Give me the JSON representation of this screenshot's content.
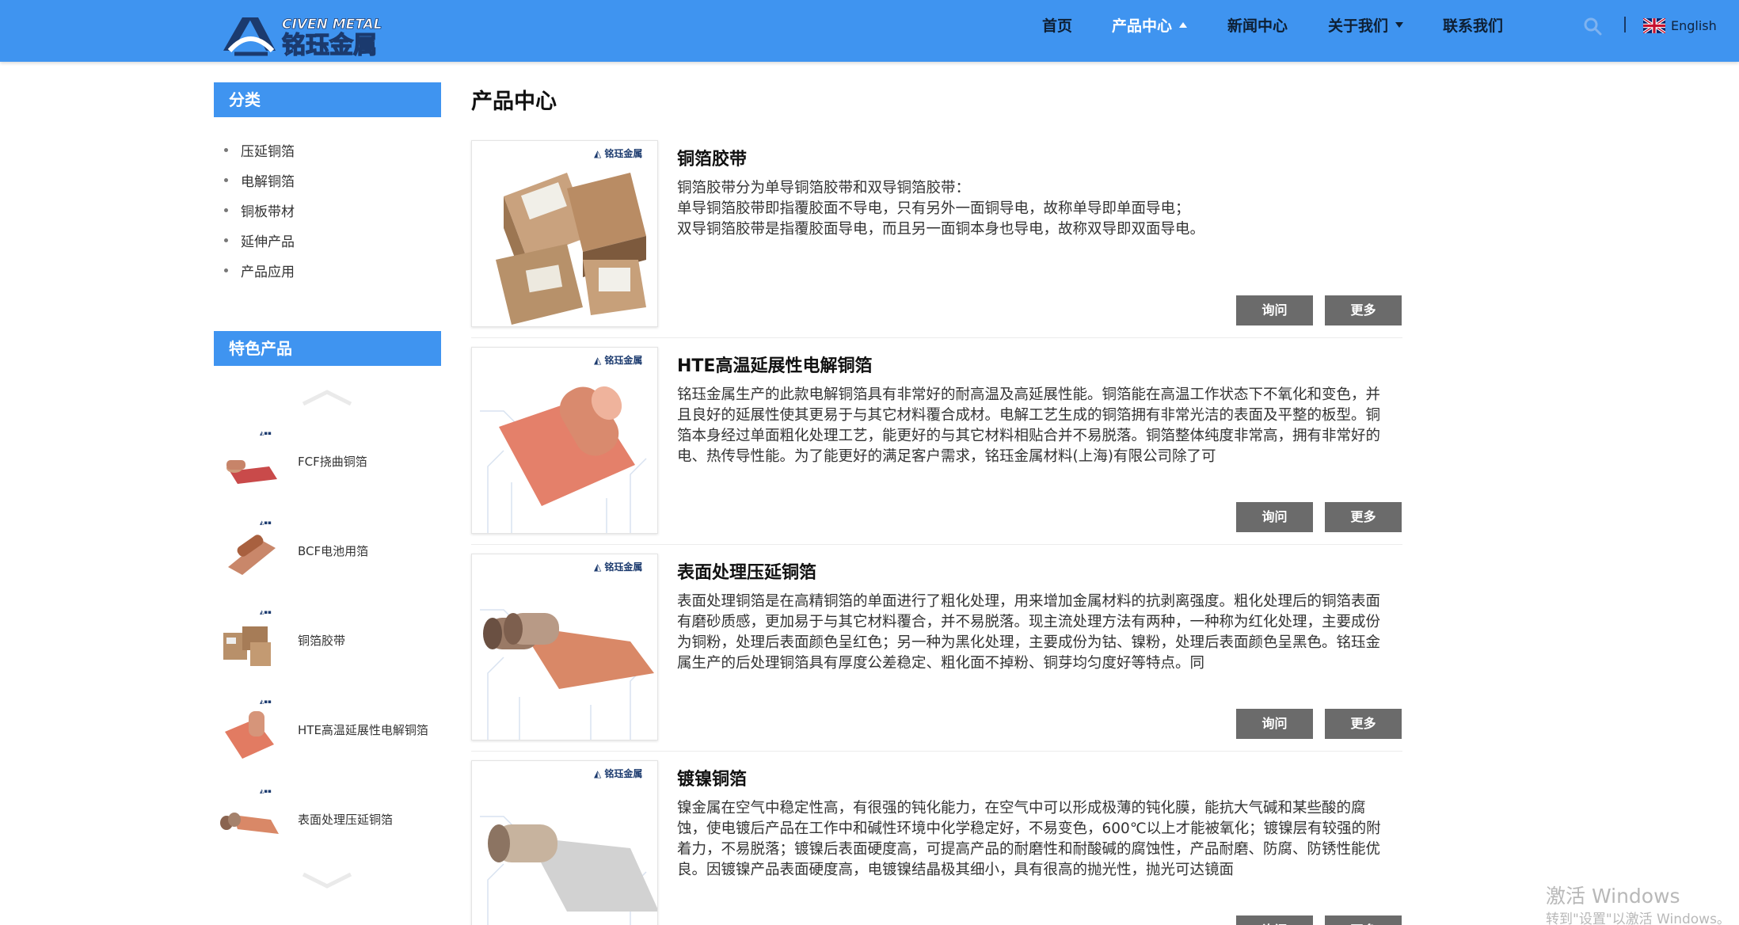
{
  "header": {
    "logo_text_en": "CIVEN METAL",
    "logo_text_cn": "铭珏金属",
    "nav": [
      {
        "label": "首页",
        "active": false,
        "caret": ""
      },
      {
        "label": "产品中心",
        "active": true,
        "caret": "up"
      },
      {
        "label": "新闻中心",
        "active": false,
        "caret": ""
      },
      {
        "label": "关于我们",
        "active": false,
        "caret": "down"
      },
      {
        "label": "联系我们",
        "active": false,
        "caret": ""
      }
    ],
    "search_icon": "search-icon",
    "language": {
      "label": "English",
      "flag_icon": "uk-flag-icon"
    }
  },
  "sidebar": {
    "category_heading": "分类",
    "categories": [
      "压延铜箔",
      "电解铜箔",
      "铜板带材",
      "延伸产品",
      "产品应用"
    ],
    "featured_heading": "特色产品",
    "featured": [
      {
        "label": "FCF挠曲铜箔"
      },
      {
        "label": "BCF电池用箔"
      },
      {
        "label": "铜箔胶带"
      },
      {
        "label": "HTE高温延展性电解铜箔"
      },
      {
        "label": "表面处理压延铜箔"
      }
    ]
  },
  "main": {
    "title": "产品中心",
    "products": [
      {
        "title": "铜箔胶带",
        "description": "铜箔胶带分为单导铜箔胶带和双导铜箔胶带：\n单导铜箔胶带即指覆胶面不导电，只有另外一面铜导电，故称单导即单面导电；\n双导铜箔胶带是指覆胶面导电，而且另一面铜本身也导电，故称双导即双面导电。",
        "inquiry_label": "询问",
        "more_label": "更多"
      },
      {
        "title": "HTE高温延展性电解铜箔",
        "description": "铭珏金属生产的此款电解铜箔具有非常好的耐高温及高延展性能。铜箔能在高温工作状态下不氧化和变色，并且良好的延展性使其更易于与其它材料覆合成材。电解工艺生成的铜箔拥有非常光洁的表面及平整的板型。铜箔本身经过单面粗化处理工艺，能更好的与其它材料相贴合并不易脱落。铜箔整体纯度非常高，拥有非常好的电、热传导性能。为了能更好的满足客户需求，铭珏金属材料(上海)有限公司除了可",
        "inquiry_label": "询问",
        "more_label": "更多"
      },
      {
        "title": "表面处理压延铜箔",
        "description": "表面处理铜箔是在高精铜箔的单面进行了粗化处理，用来增加金属材料的抗剥离强度。粗化处理后的铜箔表面有磨砂质感，更加易于与其它材料覆合，并不易脱落。现主流处理方法有两种，一种称为红化处理，主要成份为铜粉，处理后表面颜色呈红色；另一种为黑化处理，主要成份为钴、镍粉，处理后表面颜色呈黑色。铭珏金属生产的后处理铜箔具有厚度公差稳定、粗化面不掉粉、铜芽均匀度好等特点。同",
        "inquiry_label": "询问",
        "more_label": "更多"
      },
      {
        "title": "镀镍铜箔",
        "description": "镍金属在空气中稳定性高，有很强的钝化能力，在空气中可以形成极薄的钝化膜，能抗大气碱和某些酸的腐蚀，使电镀后产品在工作中和碱性环境中化学稳定好，不易变色，600℃以上才能被氧化；镀镍层有较强的附着力，不易脱落；镀镍后表面硬度高，可提高产品的耐磨性和耐酸碱的腐蚀性，产品耐磨、防腐、防锈性能优良。因镀镍产品表面硬度高，电镀镍结晶极其细小，具有很高的抛光性，抛光可达镜面",
        "inquiry_label": "询问",
        "more_label": "更多"
      }
    ]
  },
  "watermark": {
    "title": "激活 Windows",
    "subtitle": "转到\"设置\"以激活 Windows。"
  },
  "colors": {
    "header_bg": "#3f94f0",
    "nav_text": "#0e1f33",
    "nav_active": "#ffffff",
    "button_bg": "#6b6b6b",
    "copper": "#d9826a"
  }
}
